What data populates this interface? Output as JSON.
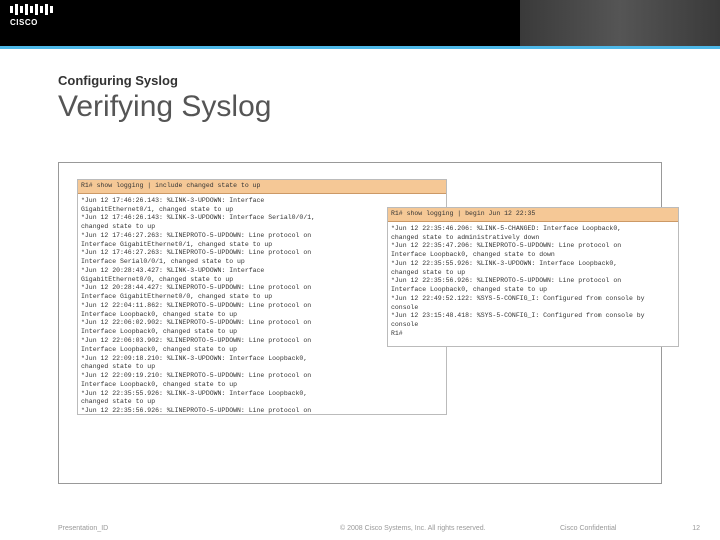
{
  "header": {
    "logo_text": "CISCO"
  },
  "slide": {
    "subtitle": "Configuring Syslog",
    "title": "Verifying Syslog"
  },
  "terminal1": {
    "command": "R1# show logging | include changed state to up",
    "output": "*Jun 12 17:46:26.143: %LINK-3-UPDOWN: Interface\nGigabitEthernet0/1, changed state to up\n*Jun 12 17:46:26.143: %LINK-3-UPDOWN: Interface Serial0/0/1,\nchanged state to up\n*Jun 12 17:46:27.263: %LINEPROTO-5-UPDOWN: Line protocol on\nInterface GigabitEthernet0/1, changed state to up\n*Jun 12 17:46:27.263: %LINEPROTO-5-UPDOWN: Line protocol on\nInterface Serial0/0/1, changed state to up\n*Jun 12 20:28:43.427: %LINK-3-UPDOWN: Interface\nGigabitEthernet0/0, changed state to up\n*Jun 12 20:28:44.427: %LINEPROTO-5-UPDOWN: Line protocol on\nInterface GigabitEthernet0/0, changed state to up\n*Jun 12 22:04:11.862: %LINEPROTO-5-UPDOWN: Line protocol on\nInterface Loopback0, changed state to up\n*Jun 12 22:06:02.902: %LINEPROTO-5-UPDOWN: Line protocol on\nInterface Loopback0, changed state to up\n*Jun 12 22:06:03.902: %LINEPROTO-5-UPDOWN: Line protocol on\nInterface Loopback0, changed state to up\n*Jun 12 22:09:18.210: %LINK-3-UPDOWN: Interface Loopback0,\nchanged state to up\n*Jun 12 22:09:19.210: %LINEPROTO-5-UPDOWN: Line protocol on\nInterface Loopback0, changed state to up\n*Jun 12 22:35:55.926: %LINK-3-UPDOWN: Interface Loopback0,\nchanged state to up\n*Jun 12 22:35:56.926: %LINEPROTO-5-UPDOWN: Line protocol on"
  },
  "terminal2": {
    "command": "R1# show logging | begin Jun 12 22:35",
    "output": "*Jun 12 22:35:46.206: %LINK-5-CHANGED: Interface Loopback0,\nchanged state to administratively down\n*Jun 12 22:35:47.206: %LINEPROTO-5-UPDOWN: Line protocol on\nInterface Loopback0, changed state to down\n*Jun 12 22:35:55.926: %LINK-3-UPDOWN: Interface Loopback0,\nchanged state to up\n*Jun 12 22:35:56.926: %LINEPROTO-5-UPDOWN: Line protocol on\nInterface Loopback0, changed state to up\n*Jun 12 22:49:52.122: %SYS-5-CONFIG_I: Configured from console by\nconsole\n*Jun 12 23:15:48.418: %SYS-5-CONFIG_I: Configured from console by\nconsole\nR1#"
  },
  "footer": {
    "presentation_id": "Presentation_ID",
    "copyright": "© 2008 Cisco Systems, Inc. All rights reserved.",
    "confidential": "Cisco Confidential",
    "page": "12"
  }
}
